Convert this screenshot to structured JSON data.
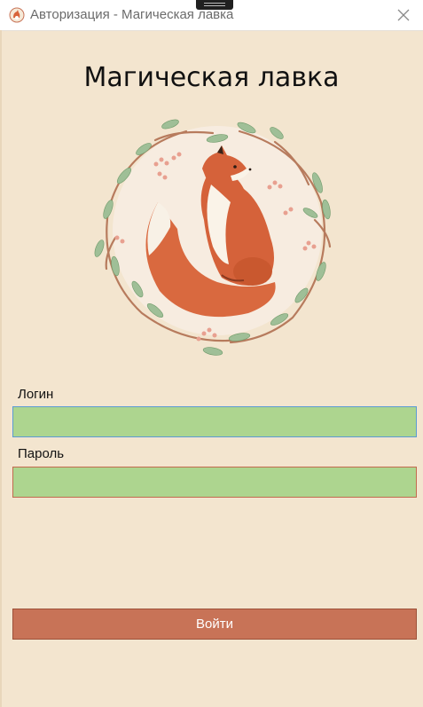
{
  "window": {
    "title": "Авторизация - Магическая лавка",
    "app_icon": "fox-app-icon",
    "close_icon": "close-icon"
  },
  "main": {
    "heading": "Магическая лавка",
    "logo": "fox-in-wreath-illustration"
  },
  "form": {
    "login_label": "Логин",
    "login_value": "",
    "password_label": "Пароль",
    "password_value": "",
    "submit_label": "Войти"
  },
  "colors": {
    "background": "#f3e5cf",
    "input_fill": "#add58f",
    "login_border": "#5b9bd5",
    "password_border": "#c26a4e",
    "button": "#c87357"
  }
}
